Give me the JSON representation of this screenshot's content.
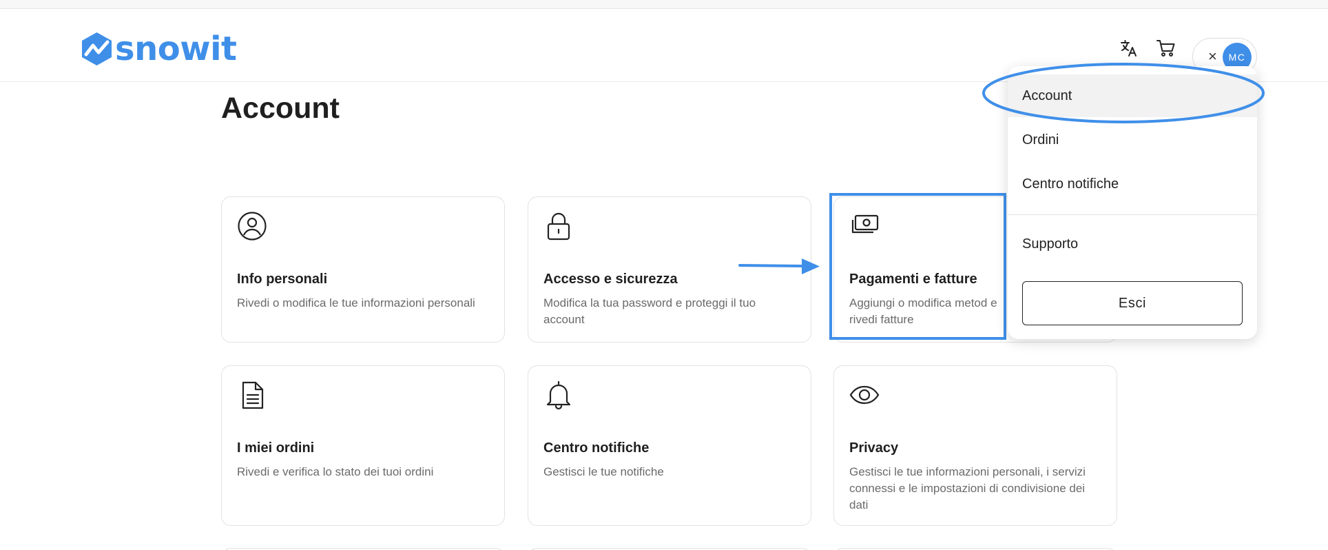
{
  "brand": {
    "name": "snowit",
    "color": "#3f8fe9"
  },
  "header": {
    "icons": [
      "translate-icon",
      "cart-icon"
    ],
    "user_menu": {
      "close_symbol": "×",
      "initials": "MC"
    }
  },
  "page": {
    "title": "Account"
  },
  "cards": [
    {
      "title": "Info personali",
      "description": "Rivedi o modifica le tue informazioni personali",
      "icon": "user-circle-icon"
    },
    {
      "title": "Accesso e sicurezza",
      "description": "Modifica la tua password e proteggi il tuo account",
      "icon": "lock-icon"
    },
    {
      "title": "Pagamenti e fatture",
      "description": "Aggiungi o modifica metod e rivedi fatture",
      "icon": "money-icon"
    },
    {
      "title": "I miei ordini",
      "description": "Rivedi e verifica lo stato dei tuoi ordini",
      "icon": "document-icon"
    },
    {
      "title": "Centro notifiche",
      "description": "Gestisci le tue notifiche",
      "icon": "bell-icon"
    },
    {
      "title": "Privacy",
      "description": "Gestisci le tue informazioni personali, i servizi connessi e le impostazioni di condivisione dei dati",
      "icon": "eye-icon"
    }
  ],
  "dropdown": {
    "items": [
      "Account",
      "Ordini",
      "Centro notifiche"
    ],
    "support": "Supporto",
    "logout": "Esci",
    "active": "Account"
  },
  "annotations": {
    "color": "#3f8fe9"
  }
}
